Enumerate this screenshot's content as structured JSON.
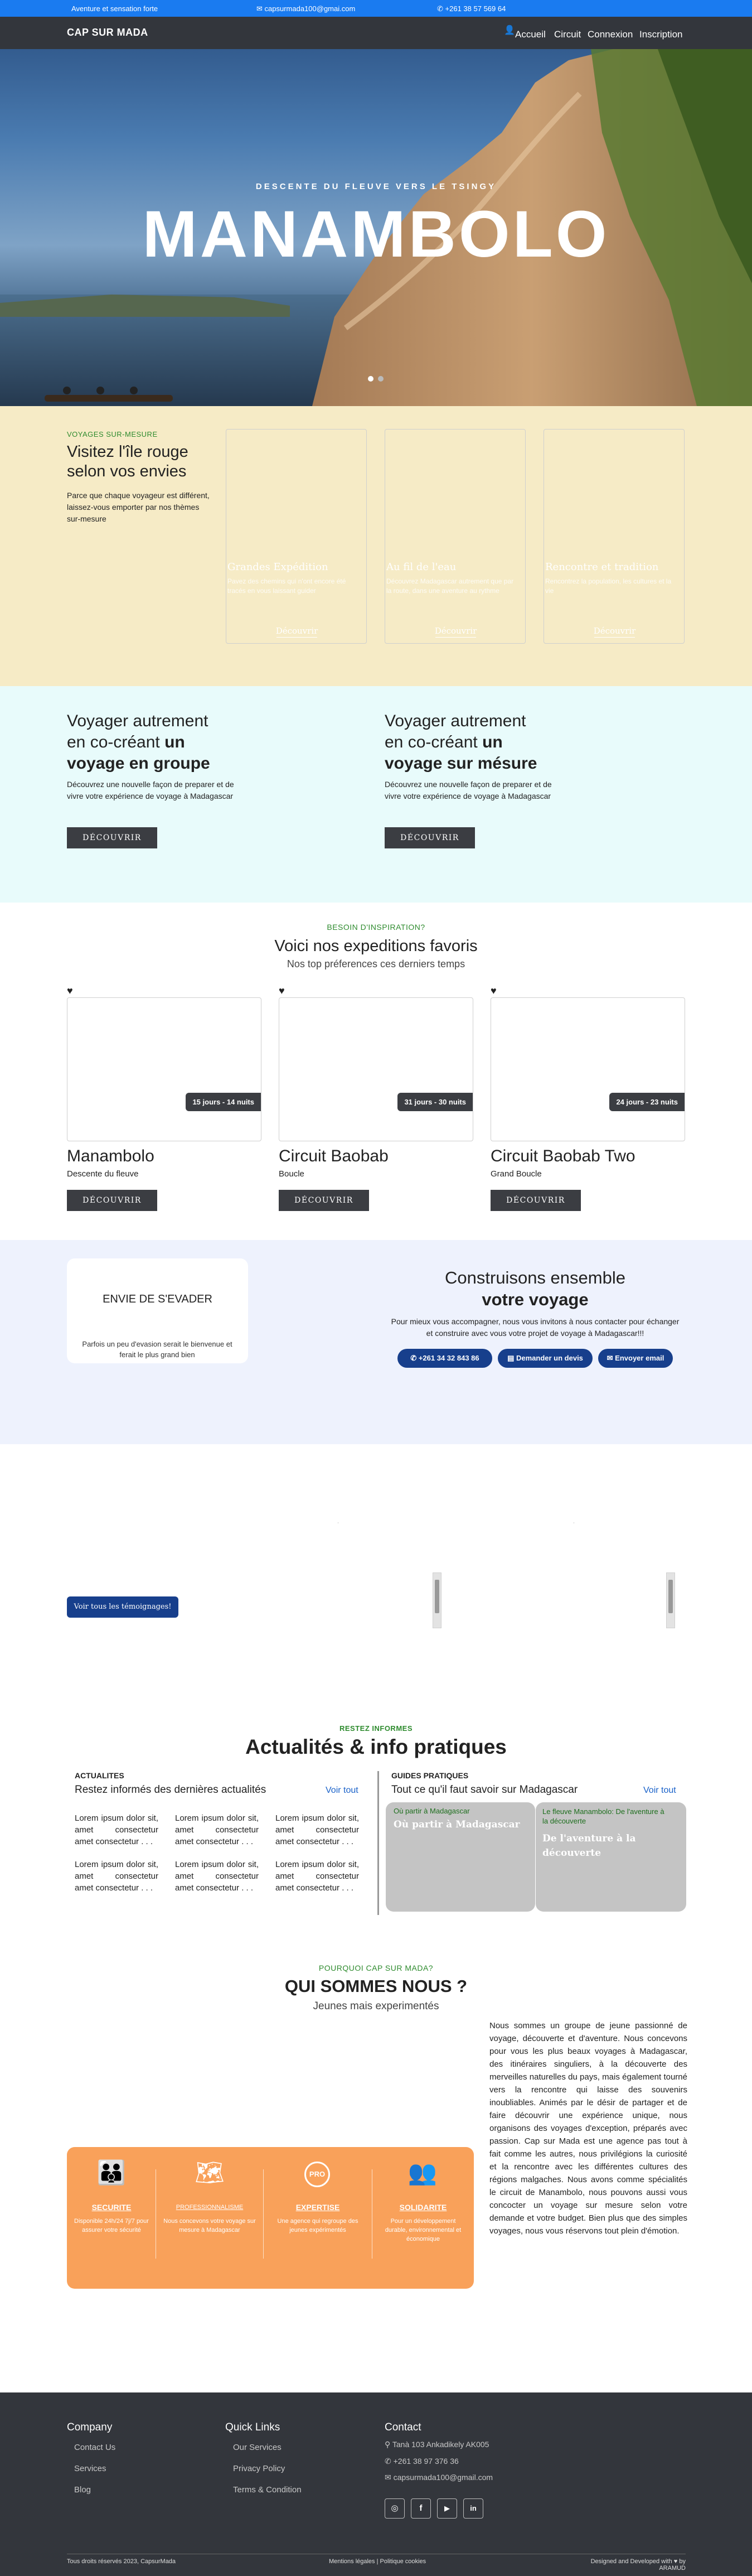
{
  "topbar": {
    "tagline": "Aventure et sensation forte",
    "email": "capsurmada100@gmai.com",
    "phone": "+261 38 57 569 64"
  },
  "nav": {
    "brand": "CAP SUR MADA",
    "items": [
      "Accueil",
      "Circuit",
      "Connexion",
      "Inscription"
    ]
  },
  "hero": {
    "subtitle": "DESCENTE DU FLEUVE VERS LE TSINGY",
    "title": "MANAMBOLO"
  },
  "themes": {
    "label": "VOYAGES SUR-MESURE",
    "title": "Visitez l'île rouge selon vos envies",
    "description": "Parce que chaque voyageur est différent, laissez-vous emporter par nos thèmes sur-mesure",
    "cards": [
      {
        "title": "Grandes Expédition",
        "text": "Pavez des chemins qui n'ont encore été tracés en vous laissant guider",
        "button": "Découvrir"
      },
      {
        "title": "Au fil de l'eau",
        "text": "Découvrez Madagascar autrement que par la route, dans une aventure au rythme",
        "button": "Découvrir"
      },
      {
        "title": "Rencontre et tradition",
        "text": "Rencontrez la population, les cultures et la vie",
        "button": "Découvrir"
      }
    ]
  },
  "travel": [
    {
      "line1": "Voyager autrement",
      "line2a": "en co-créant ",
      "line2b": "un",
      "line3": "voyage en groupe",
      "text": "Découvrez une nouvelle façon de preparer et de vivre votre expérience de voyage à Madagascar",
      "button": "DÉCOUVRIR"
    },
    {
      "line1": "Voyager autrement",
      "line2a": "en co-créant ",
      "line2b": "un",
      "line3": "voyage sur mésure",
      "text": "Découvrez une nouvelle façon de preparer et de vivre votre expérience de voyage à Madagascar",
      "button": "DÉCOUVRIR"
    }
  ],
  "favorites": {
    "label": "BESOIN D'INSPIRATION?",
    "title": "Voici nos expeditions favoris",
    "subtitle": "Nos top préferences ces derniers temps",
    "items": [
      {
        "badge": "15 jours - 14 nuits",
        "title": "Manambolo",
        "sub": "Descente du fleuve",
        "button": "DÉCOUVRIR"
      },
      {
        "badge": "31 jours - 30 nuits",
        "title": "Circuit Baobab",
        "sub": "Boucle",
        "button": "DÉCOUVRIR"
      },
      {
        "badge": "24 jours - 23 nuits",
        "title": "Circuit Baobab Two",
        "sub": "Grand Boucle",
        "button": "DÉCOUVRIR"
      }
    ]
  },
  "escape": {
    "title": "ENVIE DE S'EVADER",
    "text": "Parfois un peu d'evasion serait le bienvenue et ferait le plus grand bien"
  },
  "build": {
    "title1": "Construisons ensemble",
    "title2": "votre voyage",
    "text": "Pour mieux vous accompagner, nous vous invitons à nous contacter pour échanger et construire avec vous votre projet de voyage à Madagascar!!!",
    "buttons": [
      "+261 34 32 843 86",
      "Demander un devis",
      "Envoyer email"
    ]
  },
  "testimonials": {
    "button": "Voir tous les témoignages!"
  },
  "news": {
    "label": "RESTEZ INFORMES",
    "title": "Actualités & info pratiques",
    "left_label": "ACTUALITES",
    "left_title": "Restez informés des dernières actualités",
    "left_link": "Voir tout",
    "lorem": "Lorem ipsum dolor sit, amet consectetur amet consectetur . . .",
    "right_label": "GUIDES PRATIQUES",
    "right_title": "Tout ce qu'il faut savoir sur Madagascar",
    "right_link": "Voir tout",
    "guides": [
      {
        "tag": "Où partir à Madagascar",
        "title": "Où partir à Madagascar"
      },
      {
        "tag": "Le fleuve Manambolo: De l'aventure à la découverte",
        "title": "De l'aventure à la découverte"
      }
    ]
  },
  "about": {
    "label": "POURQUOI CAP SUR MADA?",
    "title": "QUI SOMMES NOUS ?",
    "subtitle": "Jeunes mais experimentés",
    "text": "Nous sommes un groupe de jeune passionné de voyage, découverte et d'aventure. Nous concevons pour vous les plus beaux voyages à Madagascar, des itinéraires singuliers, à la découverte des merveilles naturelles du pays, mais également tourné vers la rencontre qui laisse des souvenirs inoubliables. Animés par le désir de partager et de faire découvrir une expérience unique, nous organisons des voyages d'exception, préparés avec passion. Cap sur Mada est une agence pas tout à fait comme les autres, nous privilégions la curiosité et la rencontre avec les différentes cultures des régions malgaches. Nous avons comme spécialités le circuit de Manambolo, nous pouvons aussi vous concocter un voyage sur mesure selon votre demande et votre budget. Bien plus que des simples voyages, nous vous réservons tout plein d'émotion.",
    "features": [
      {
        "title": "SECURITE",
        "text": "Disponible 24h/24 7j/7 pour assurer votre sécurité"
      },
      {
        "title": "PROFESSIONNALISME",
        "text": "Nous concevons votre voyage sur mesure à Madagascar"
      },
      {
        "title": "EXPERTISE",
        "text": "Une agence qui regroupe des jeunes expérimentés"
      },
      {
        "title": "SOLIDARITE",
        "text": "Pour un développement durable, environnemental et économique"
      }
    ],
    "pro_badge": "PRO"
  },
  "footer": {
    "company_title": "Company",
    "company_links": [
      "Contact Us",
      "Services",
      "Blog"
    ],
    "quick_title": "Quick Links",
    "quick_links": [
      "Our Services",
      "Privacy Policy",
      "Terms & Condition"
    ],
    "contact_title": "Contact",
    "address": "Tanà 103 Ankadikely AK005",
    "phone": "+261 38 97 376 36",
    "email": "capsurmada100@gmail.com",
    "copyright": "Tous droits réservés 2023, CapsurMada",
    "legal": "Mentions légales | Politique cookies",
    "credit": "Designed and Developed with ♥ by ARAMUD"
  },
  "colors": {
    "topbar": "#1a7bf0",
    "nav": "#33363c",
    "cream": "#f6ebc6",
    "mint": "#e8fbfb",
    "lavender": "#eef2fd",
    "accent_green": "#2e8b2e",
    "accent_blue": "#173f8c",
    "orange": "#f9a15a",
    "footer": "#33363c"
  }
}
